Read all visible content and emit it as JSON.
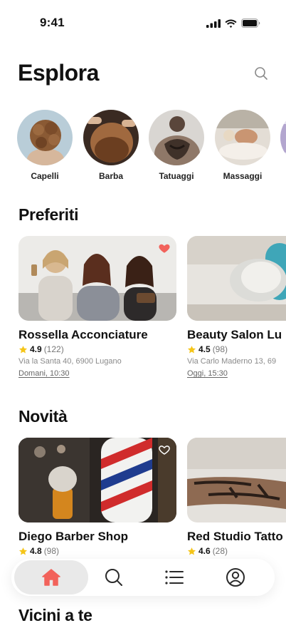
{
  "status": {
    "time": "9:41"
  },
  "header": {
    "title": "Esplora"
  },
  "categories": [
    {
      "label": "Capelli"
    },
    {
      "label": "Barba"
    },
    {
      "label": "Tatuaggi"
    },
    {
      "label": "Massaggi"
    }
  ],
  "favorites": {
    "title": "Preferiti",
    "cards": [
      {
        "name": "Rossella Acconciature",
        "rating": "4.9",
        "count": "(122)",
        "address": "Via la Santa 40, 6900 Lugano",
        "slot": "Domani, 10:30",
        "favorited": true
      },
      {
        "name": "Beauty Salon Lu",
        "rating": "4.5",
        "count": "(98)",
        "address": "Via Carlo Maderno 13, 69",
        "slot": "Oggi, 15:30",
        "favorited": false
      }
    ]
  },
  "news": {
    "title": "Novità",
    "cards": [
      {
        "name": "Diego Barber Shop",
        "rating": "4.8",
        "count": "(98)",
        "favorited": false
      },
      {
        "name": "Red Studio Tatto",
        "rating": "4.6",
        "count": "(28)",
        "favorited": false
      }
    ]
  },
  "nearby": {
    "title": "Vicini a te"
  },
  "tabbar": {
    "items": [
      {
        "icon": "home-icon",
        "active": true
      },
      {
        "icon": "search-icon",
        "active": false
      },
      {
        "icon": "list-icon",
        "active": false
      },
      {
        "icon": "profile-icon",
        "active": false
      }
    ]
  },
  "colors": {
    "accent": "#f2625b",
    "star": "#f5c518"
  }
}
